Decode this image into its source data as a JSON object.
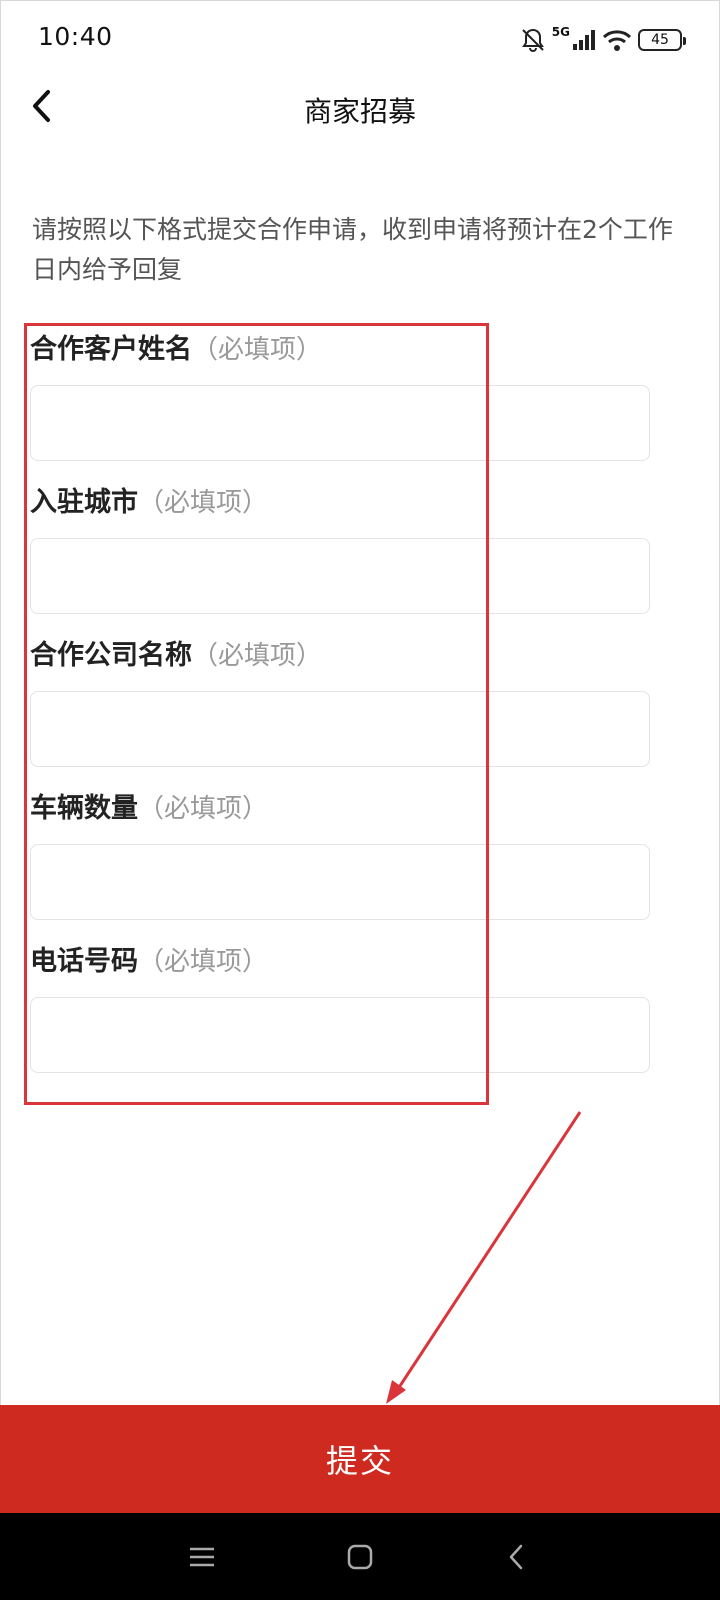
{
  "status_bar": {
    "time": "10:40",
    "network": "5G",
    "battery": "45",
    "icons": [
      "bell-off-icon",
      "signal-icon",
      "wifi-icon",
      "battery-icon"
    ]
  },
  "header": {
    "title": "商家招募",
    "back_icon": "chevron-left-icon"
  },
  "intro": {
    "text": "请按照以下格式提交合作申请，收到申请将预计在2个工作日内给予回复"
  },
  "form": {
    "fields": [
      {
        "label": "合作客户姓名",
        "hint": "（必填项）",
        "value": ""
      },
      {
        "label": "入驻城市",
        "hint": "（必填项）",
        "value": ""
      },
      {
        "label": "合作公司名称",
        "hint": "（必填项）",
        "value": ""
      },
      {
        "label": "车辆数量",
        "hint": "（必填项）",
        "value": ""
      },
      {
        "label": "电话号码",
        "hint": "（必填项）",
        "value": ""
      }
    ]
  },
  "submit": {
    "label": "提交"
  },
  "system_nav": {
    "icons": [
      "menu-icon",
      "home-icon",
      "back-icon"
    ]
  },
  "colors": {
    "accent": "#cf2a20",
    "annotation": "#d9353a",
    "hint": "#999999",
    "intro": "#555555"
  }
}
